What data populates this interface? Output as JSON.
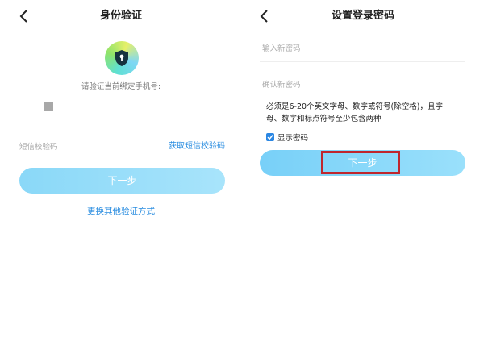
{
  "left": {
    "title": "身份验证",
    "hint": "请验证当前绑定手机号:",
    "sms_placeholder": "短信校验码",
    "get_code": "获取短信校验码",
    "next": "下一步",
    "alt_method": "更换其他验证方式",
    "icons": {
      "back": "back-arrow-icon",
      "badge": "shield-lock-icon"
    }
  },
  "right": {
    "title": "设置登录密码",
    "new_password_placeholder": "输入新密码",
    "confirm_password_placeholder": "确认新密码",
    "rule_line1": "必须是6-20个英文字母、数字或符号(除空格)，且字",
    "rule_line2": "母、数字和标点符号至少包含两种",
    "show_password": "显示密码",
    "show_password_checked": true,
    "next": "下一步",
    "icons": {
      "back": "back-arrow-icon",
      "check": "checkmark-icon"
    }
  },
  "colors": {
    "accent": "#2a8de0",
    "button": "#8ad8f8",
    "highlight": "#c0262d"
  }
}
